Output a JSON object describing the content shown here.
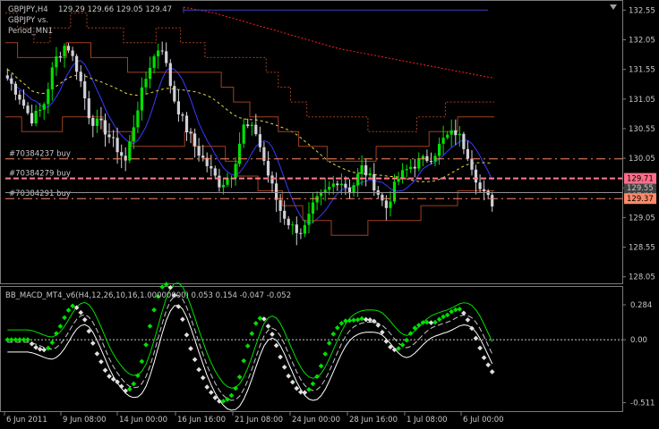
{
  "main_window": {
    "title": "GBPJPY,H4",
    "ohlc": "129.29 129.66 129.05 129.47",
    "comment_line1": "GBPJPY vs.",
    "comment_line2": "Period_MN1"
  },
  "price_axis": {
    "ticks": [
      "132.55",
      "132.05",
      "131.55",
      "131.05",
      "130.55",
      "130.05",
      "129.55",
      "129.05",
      "128.55",
      "128.05"
    ],
    "badges": [
      {
        "label": "129.71",
        "color": "#ff6c8a"
      },
      {
        "label": "129.37",
        "color": "#ff8866"
      }
    ],
    "hidden_labels": [
      "129.47",
      "129.55"
    ]
  },
  "orders": [
    {
      "label": "#70384237 buy",
      "price": 130.04
    },
    {
      "label": "#70384279 buy",
      "price": 129.71
    },
    {
      "label": "#70384291 buy",
      "price": 129.37
    }
  ],
  "indicator": {
    "title": "BB_MACD_MT4_v6(H4,12,26,10,16,1.00000000) 0.053 0.154 -0.047 -0.052",
    "ticks": [
      "0.284",
      "0.00",
      "-0.511"
    ]
  },
  "time_axis": {
    "labels": [
      "6 Jun 2011",
      "9 Jun 08:00",
      "14 Jun 00:00",
      "16 Jun 16:00",
      "21 Jun 08:00",
      "24 Jun 00:00",
      "28 Jun 16:00",
      "1 Jul 08:00",
      "6 Jul 00:00"
    ]
  },
  "colors": {
    "background": "#000000",
    "bull_candle": "#00e000",
    "bear_candle": "#d0d0d8",
    "grid": "#7a7a7a",
    "order_line": "#ff8866",
    "ma_fast": "#3a3aff",
    "ma_slow": "#e6d84a",
    "resistance": "#ff2020",
    "envelope": "#a04020"
  },
  "chart_data": {
    "type": "candlestick",
    "symbol": "GBPJPY",
    "timeframe": "H4",
    "ylim": [
      128.0,
      132.6
    ],
    "close_path": [
      131.4,
      131.1,
      130.7,
      130.9,
      131.7,
      132.0,
      131.5,
      130.7,
      130.6,
      130.3,
      130.0,
      130.9,
      131.6,
      132.0,
      131.1,
      130.6,
      130.2,
      129.9,
      129.6,
      129.8,
      130.6,
      130.5,
      129.8,
      129.2,
      128.9,
      128.8,
      129.3,
      129.5,
      129.7,
      129.5,
      129.9,
      129.6,
      129.2,
      129.7,
      129.9,
      130.0,
      130.1,
      130.4,
      130.5,
      130.1,
      129.5,
      129.3
    ],
    "macd_ylim": [
      -0.55,
      0.32
    ]
  }
}
